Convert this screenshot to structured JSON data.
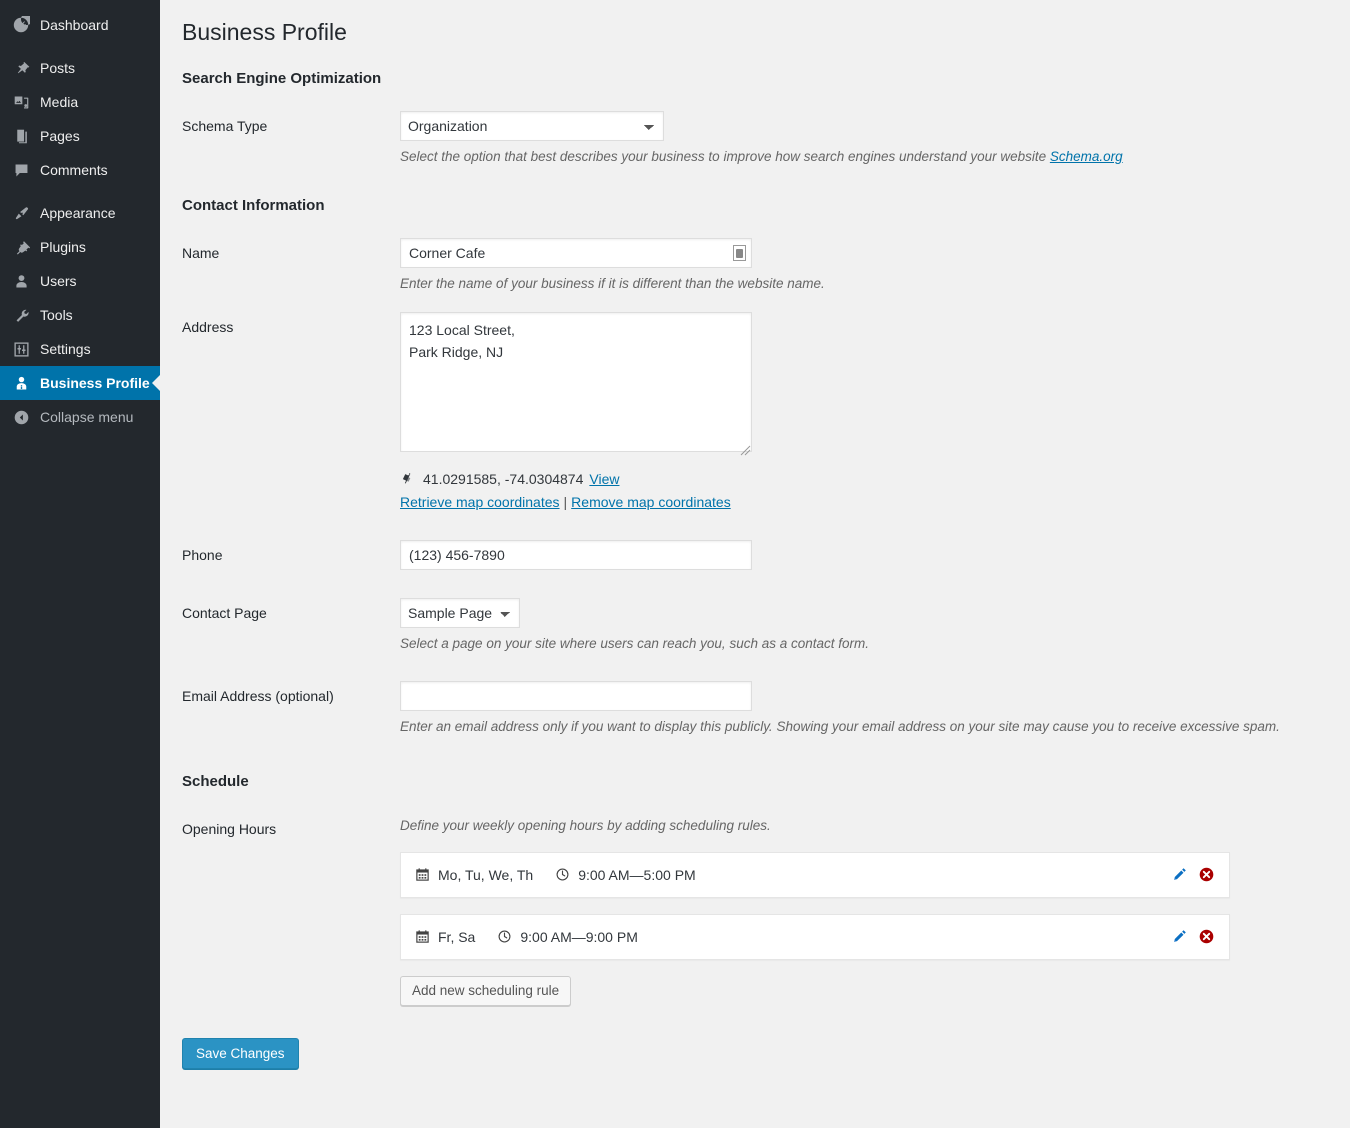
{
  "sidebar": {
    "items": [
      {
        "label": "Dashboard",
        "icon": "dashboard-icon",
        "current": false,
        "sep_after": true
      },
      {
        "label": "Posts",
        "icon": "pin-icon",
        "current": false,
        "sep_after": false
      },
      {
        "label": "Media",
        "icon": "media-icon",
        "current": false,
        "sep_after": false
      },
      {
        "label": "Pages",
        "icon": "pages-icon",
        "current": false,
        "sep_after": false
      },
      {
        "label": "Comments",
        "icon": "comments-icon",
        "current": false,
        "sep_after": true
      },
      {
        "label": "Appearance",
        "icon": "paintbrush-icon",
        "current": false,
        "sep_after": false
      },
      {
        "label": "Plugins",
        "icon": "plugin-icon",
        "current": false,
        "sep_after": false
      },
      {
        "label": "Users",
        "icon": "user-icon",
        "current": false,
        "sep_after": false
      },
      {
        "label": "Tools",
        "icon": "wrench-icon",
        "current": false,
        "sep_after": false
      },
      {
        "label": "Settings",
        "icon": "sliders-icon",
        "current": false,
        "sep_after": false
      },
      {
        "label": "Business Profile",
        "icon": "business-profile-icon",
        "current": true,
        "sep_after": false
      }
    ],
    "collapse_label": "Collapse menu",
    "collapse_icon": "collapse-arrow-icon",
    "active_color": "#0073aa",
    "background_color": "#23282d"
  },
  "page": {
    "title": "Business Profile"
  },
  "seo": {
    "heading": "Search Engine Optimization",
    "schema_type_label": "Schema Type",
    "schema_type_value": "Organization",
    "schema_type_options": [
      "Organization"
    ],
    "schema_desc_text": "Select the option that best describes your business to improve how search engines understand your website ",
    "schema_desc_link": "Schema.org"
  },
  "contact": {
    "heading": "Contact Information",
    "name_label": "Name",
    "name_value": "Corner Cafe",
    "name_placeholder": "",
    "name_desc": "Enter the name of your business if it is different than the website name.",
    "name_autofill_icon": "contact-card-icon",
    "address_label": "Address",
    "address_value": "123 Local Street,\nPark Ridge, NJ",
    "address_placeholder": "",
    "coords_icon": "location-marker-icon",
    "coords_value": "41.0291585, -74.0304874",
    "coords_view_label": "View",
    "retrieve_label": "Retrieve map coordinates",
    "coords_separator": "|",
    "remove_label": "Remove map coordinates",
    "phone_label": "Phone",
    "phone_value": "(123) 456-7890",
    "phone_placeholder": "",
    "contact_page_label": "Contact Page",
    "contact_page_value": "Sample Page",
    "contact_page_options": [
      "Sample Page"
    ],
    "contact_page_desc": "Select a page on your site where users can reach you, such as a contact form.",
    "email_label": "Email Address (optional)",
    "email_value": "",
    "email_placeholder": "",
    "email_desc": "Enter an email address only if you want to display this publicly. Showing your email address on your site may cause you to receive excessive spam."
  },
  "schedule": {
    "heading": "Schedule",
    "opening_hours_label": "Opening Hours",
    "opening_hours_desc": "Define your weekly opening hours by adding scheduling rules.",
    "rules": [
      {
        "days": "Mo, Tu, We, Th",
        "hours": "9:00 AM—5:00 PM",
        "calendar_icon": "calendar-icon",
        "clock_icon": "clock-icon",
        "edit_icon": "pencil-edit-icon",
        "delete_icon": "delete-circle-icon"
      },
      {
        "days": "Fr, Sa",
        "hours": "9:00 AM—9:00 PM",
        "calendar_icon": "calendar-icon",
        "clock_icon": "clock-icon",
        "edit_icon": "pencil-edit-icon",
        "delete_icon": "delete-circle-icon"
      }
    ],
    "add_rule_label": "Add new scheduling rule"
  },
  "footer": {
    "save_label": "Save Changes",
    "save_color": "#2b93c4"
  }
}
